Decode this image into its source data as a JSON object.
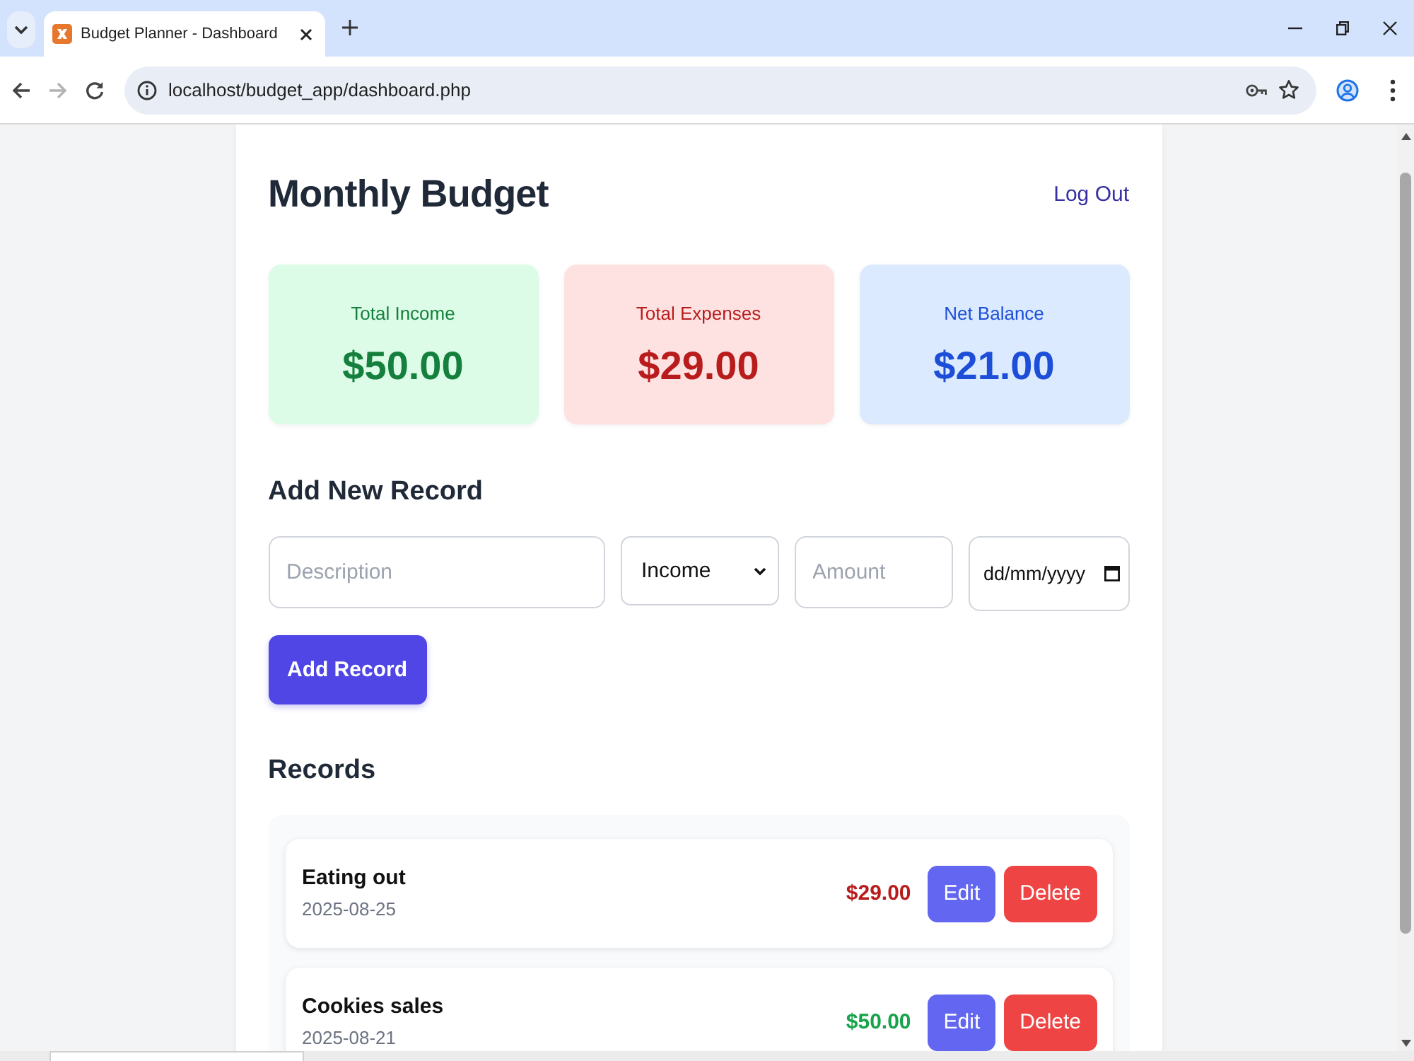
{
  "browser": {
    "tabs": [
      {
        "title": "Budget Planner - Dashboard",
        "selected": true
      }
    ],
    "nav_buttons": [
      {
        "kind": "back",
        "disabled": false
      },
      {
        "kind": "forward",
        "disabled": true
      },
      {
        "kind": "reload",
        "disabled": false
      }
    ],
    "address": "localhost/budget_app/dashboard.php"
  },
  "page": {
    "title": "Monthly Budget",
    "logout": "Log Out",
    "summary": [
      {
        "kind": "income",
        "label": "Total Income",
        "value": "$50.00"
      },
      {
        "kind": "expense",
        "label": "Total Expenses",
        "value": "$29.00"
      },
      {
        "kind": "balance",
        "label": "Net Balance",
        "value": "$21.00"
      }
    ],
    "form": {
      "heading": "Add New Record",
      "description": {
        "placeholder": "Description"
      },
      "type": {
        "value": "Income"
      },
      "amount": {
        "placeholder": "Amount"
      },
      "date": {
        "placeholder": "dd/mm/yyyy"
      },
      "submit": "Add Record"
    },
    "records_heading": "Records",
    "records": [
      {
        "kind": "expense",
        "description": "Eating out",
        "date": "2025-08-25",
        "amount": "$29.00",
        "actions": [
          {
            "kind": "edit",
            "label": "Edit"
          },
          {
            "kind": "delete",
            "label": "Delete"
          }
        ]
      },
      {
        "kind": "income",
        "description": "Cookies sales",
        "date": "2025-08-21",
        "amount": "$50.00",
        "actions": [
          {
            "kind": "edit",
            "label": "Edit"
          },
          {
            "kind": "delete",
            "label": "Delete"
          }
        ]
      }
    ]
  }
}
